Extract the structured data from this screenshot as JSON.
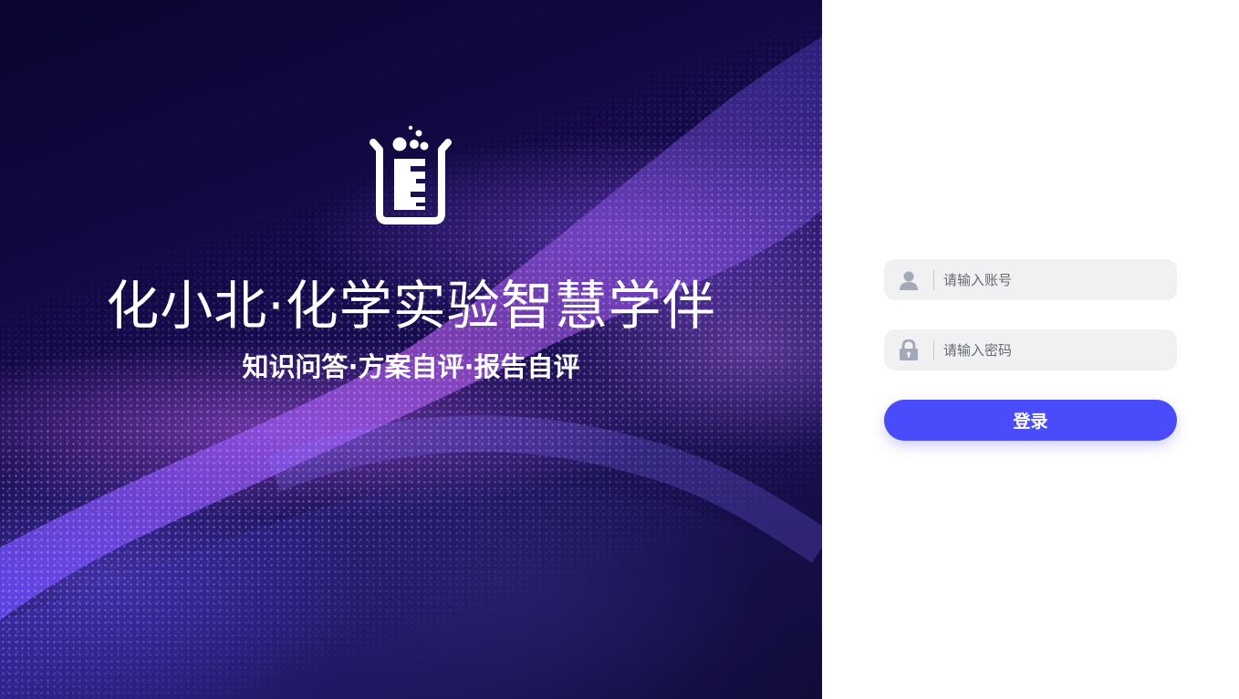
{
  "hero": {
    "title": "化小北·化学实验智慧学伴",
    "subtitle": "知识问答·方案自评·报告自评",
    "logo_icon": "beaker-icon"
  },
  "login": {
    "account_placeholder": "请输入账号",
    "account_icon": "user-icon",
    "password_placeholder": "请输入密码",
    "password_icon": "lock-icon",
    "submit_label": "登录"
  },
  "colors": {
    "accent": "#4a4cfc",
    "field_bg": "#f1f1f3",
    "hero_dark": "#0b0530",
    "hero_purple": "#b056e6"
  }
}
